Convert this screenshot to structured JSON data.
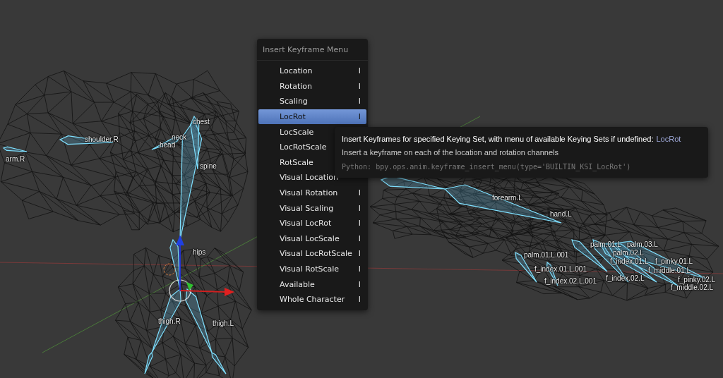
{
  "viewport": {
    "bones": [
      {
        "label": "shoulder.R"
      },
      {
        "label": "arm.R"
      },
      {
        "label": "chest"
      },
      {
        "label": "neck"
      },
      {
        "label": "head"
      },
      {
        "label": "spine"
      },
      {
        "label": "hips"
      },
      {
        "label": "thigh.R"
      },
      {
        "label": "thigh.L"
      },
      {
        "label": "forearm.L"
      },
      {
        "label": "hand.L"
      },
      {
        "label": "palm.01.L.001"
      },
      {
        "label": "f_index.01.L.001"
      },
      {
        "label": "f_index.02.L.001"
      },
      {
        "label": "palm.01.L"
      },
      {
        "label": "palm.03.L"
      },
      {
        "label": "palm.02.L"
      },
      {
        "label": "f_index.01.L"
      },
      {
        "label": "f_pinky.01.L"
      },
      {
        "label": "f_middle.01.L"
      },
      {
        "label": "f_index.02.L"
      },
      {
        "label": "f_pinky.02.L"
      },
      {
        "label": "f_middle.02.L"
      }
    ]
  },
  "menu": {
    "title": "Insert Keyframe Menu",
    "items": [
      {
        "label": "Location",
        "shortcut": "I",
        "selected": false
      },
      {
        "label": "Rotation",
        "shortcut": "I",
        "selected": false
      },
      {
        "label": "Scaling",
        "shortcut": "I",
        "selected": false
      },
      {
        "label": "LocRot",
        "shortcut": "I",
        "selected": true
      },
      {
        "label": "LocScale",
        "selected": false
      },
      {
        "label": "LocRotScale",
        "selected": false
      },
      {
        "label": "RotScale",
        "selected": false
      },
      {
        "label": "Visual Location",
        "selected": false
      },
      {
        "label": "Visual Rotation",
        "shortcut": "I",
        "selected": false
      },
      {
        "label": "Visual Scaling",
        "shortcut": "I",
        "selected": false
      },
      {
        "label": "Visual LocRot",
        "shortcut": "I",
        "selected": false
      },
      {
        "label": "Visual LocScale",
        "shortcut": "I",
        "selected": false
      },
      {
        "label": "Visual LocRotScale",
        "shortcut": "I",
        "selected": false
      },
      {
        "label": "Visual RotScale",
        "shortcut": "I",
        "selected": false
      },
      {
        "label": "Available",
        "shortcut": "I",
        "selected": false
      },
      {
        "label": "Whole Character",
        "shortcut": "I",
        "selected": false
      }
    ]
  },
  "tooltip": {
    "description": "Insert Keyframes for specified Keying Set, with menu of available Keying Sets if undefined:",
    "value": "LocRot",
    "detail": "Insert a keyframe on each of the location and rotation channels",
    "python": "Python: bpy.ops.anim.keyframe_insert_menu(type='BUILTIN_KSI_LocRot')"
  }
}
